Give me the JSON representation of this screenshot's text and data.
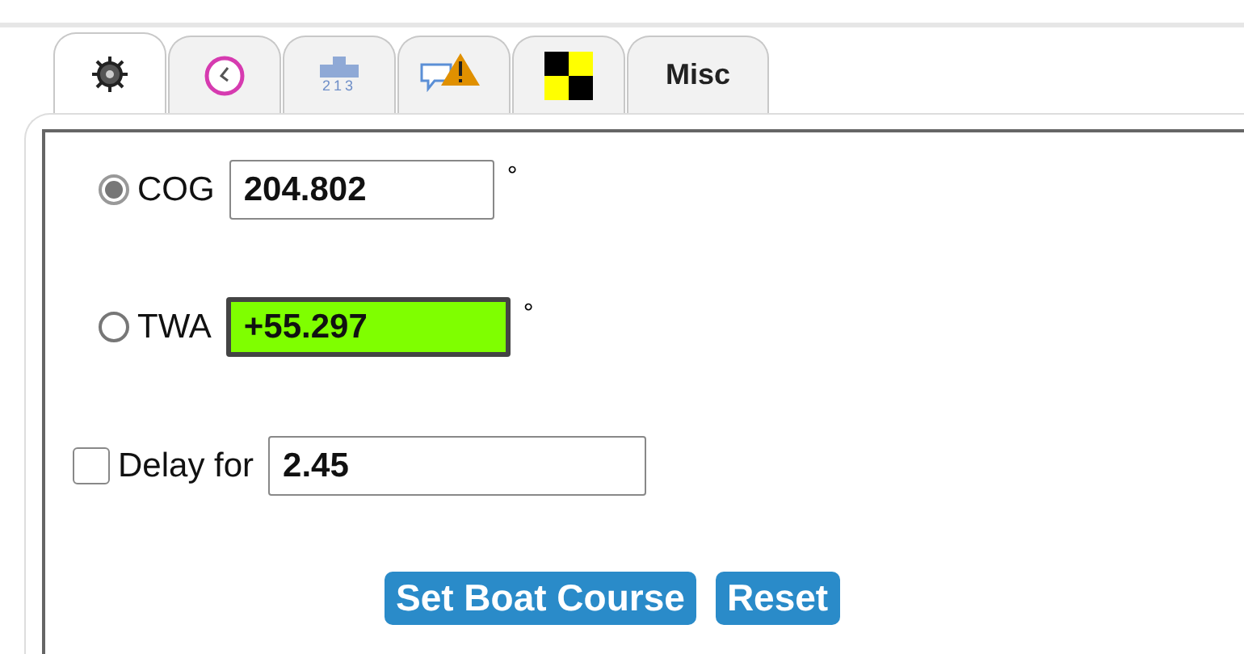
{
  "tabs": [
    {
      "kind": "helm",
      "selected": true
    },
    {
      "kind": "clock",
      "selected": false
    },
    {
      "kind": "ranking",
      "text": "213",
      "selected": false
    },
    {
      "kind": "alert",
      "selected": false
    },
    {
      "kind": "flag",
      "selected": false
    },
    {
      "kind": "text",
      "label": "Misc",
      "selected": false
    }
  ],
  "course_options": [
    {
      "label": "COG",
      "value": "204.802",
      "unit": "°",
      "selected": true,
      "highlighted": false
    },
    {
      "label": "TWA",
      "value": "+55.297",
      "unit": "°",
      "selected": false,
      "highlighted": true
    }
  ],
  "delay": {
    "label": "Delay for",
    "value": "2.45",
    "checked": false
  },
  "buttons": [
    "Set Boat Course",
    "Reset"
  ]
}
